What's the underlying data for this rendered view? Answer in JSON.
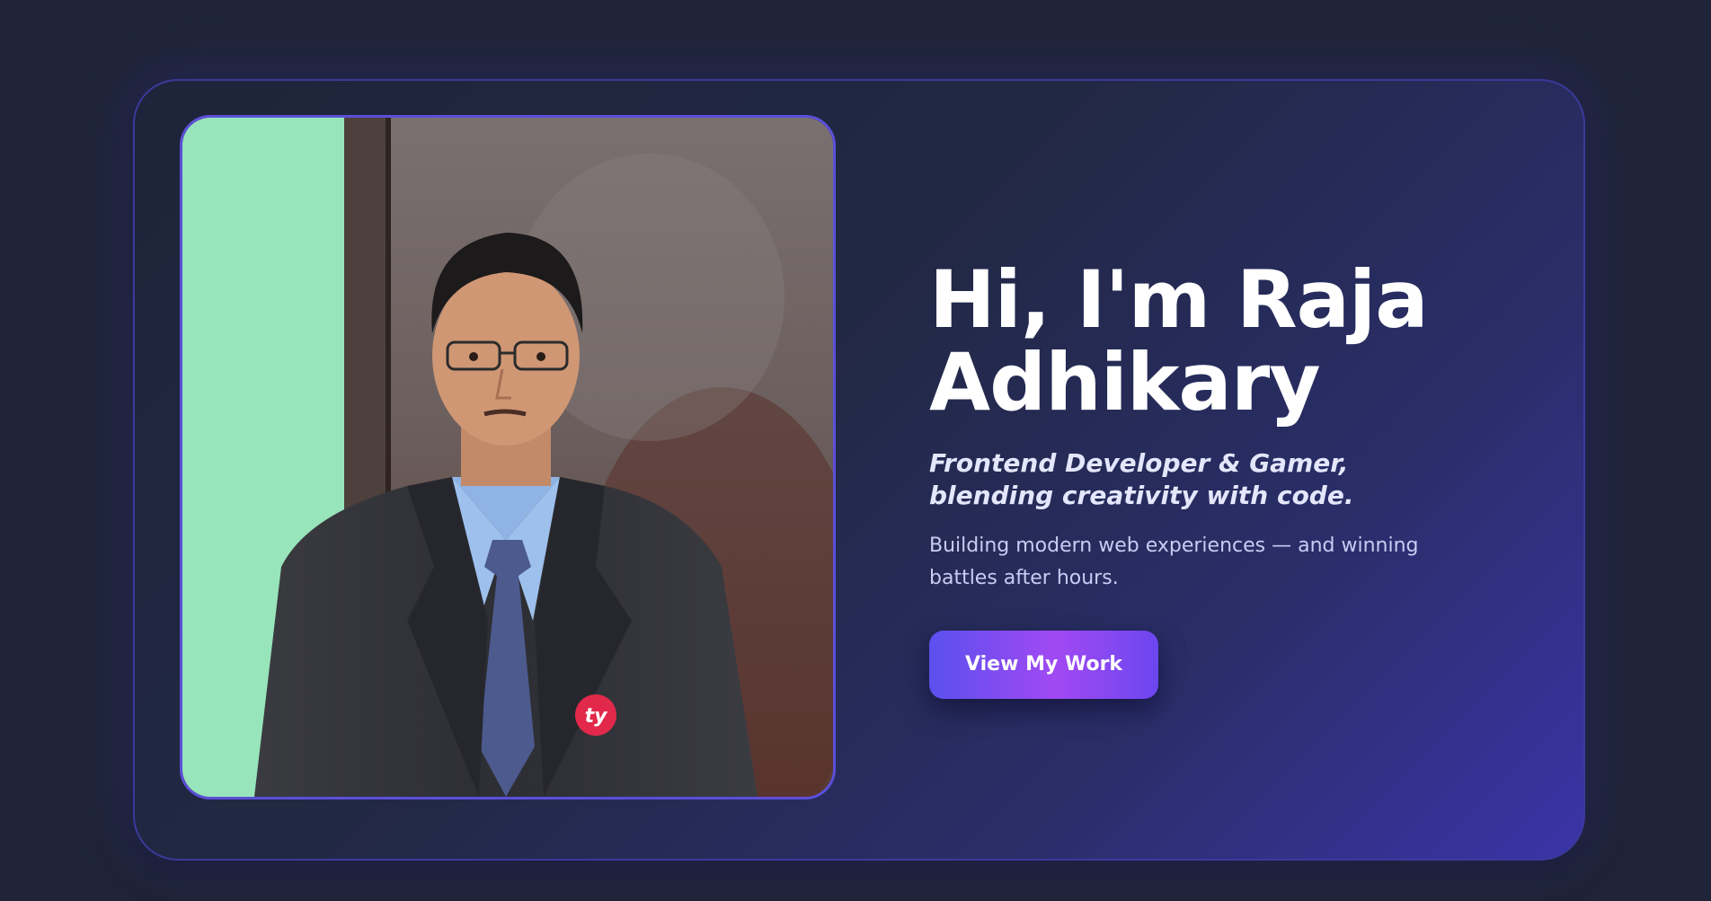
{
  "hero": {
    "title_line1": "Hi, I'm Raja",
    "title_line2": "Adhikary",
    "subtitle": "Frontend Developer & Gamer, blending creativity with code.",
    "description": "Building modern web experiences — and winning battles after hours.",
    "cta_label": "View My Work",
    "photo_badge": "ty"
  },
  "colors": {
    "background": "#1f2438",
    "card_border": "#3a3a9c",
    "accent_start": "#5a50ee",
    "accent_mid": "#a149f2",
    "title": "#ffffff",
    "subtitle": "#e4e6fb",
    "description": "#c9ccf3"
  }
}
